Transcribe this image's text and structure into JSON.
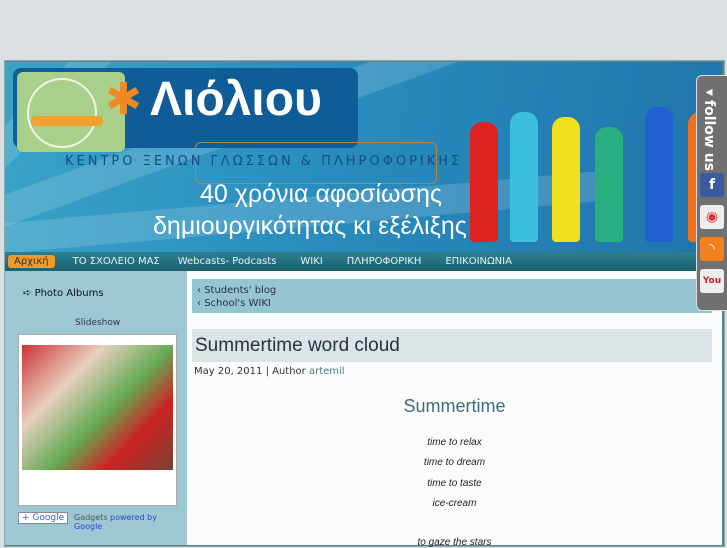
{
  "header": {
    "brand": "Λιόλιου",
    "subtitle": "ΚΕΝΤΡΟ ΞΕΝΩΝ  ΓΛΩΣΣΩΝ & ΠΛΗΡΟΦΟΡΙΚΗΣ",
    "slogan_line1": "40 χρόνια αφοσίωσης",
    "slogan_line2": "δημιουργικότητας κι εξέλιξης"
  },
  "nav": {
    "items": [
      "Αρχική",
      "ΤΟ ΣΧΟΛΕΙΟ ΜΑΣ",
      "Webcasts- Podcasts",
      "WIKI",
      "ΠΛΗΡΟΦΟΡΙΚΗ",
      "ΕΠΙΚΟΙΝΩΝΙΑ"
    ]
  },
  "sidebar": {
    "photo_albums": "Photo Albums",
    "slideshow": "Slideshow",
    "google_button": "+ Google",
    "gadgets": "Gadgets",
    "powered": "powered by Google"
  },
  "links": [
    "Students' blog",
    "School's WIKI"
  ],
  "post": {
    "title": "Summertime word cloud",
    "date": "May 20, 2011 | Author ",
    "author": "artemil",
    "heading": "Summertime",
    "lines": [
      "time to relax",
      "time to dream",
      "time to taste",
      "ice-cream",
      "to gaze the stars"
    ]
  },
  "follow": {
    "label": "◂follow us",
    "icons": [
      "facebook-icon",
      "picasa-icon",
      "rss-icon",
      "youtube-icon"
    ]
  }
}
